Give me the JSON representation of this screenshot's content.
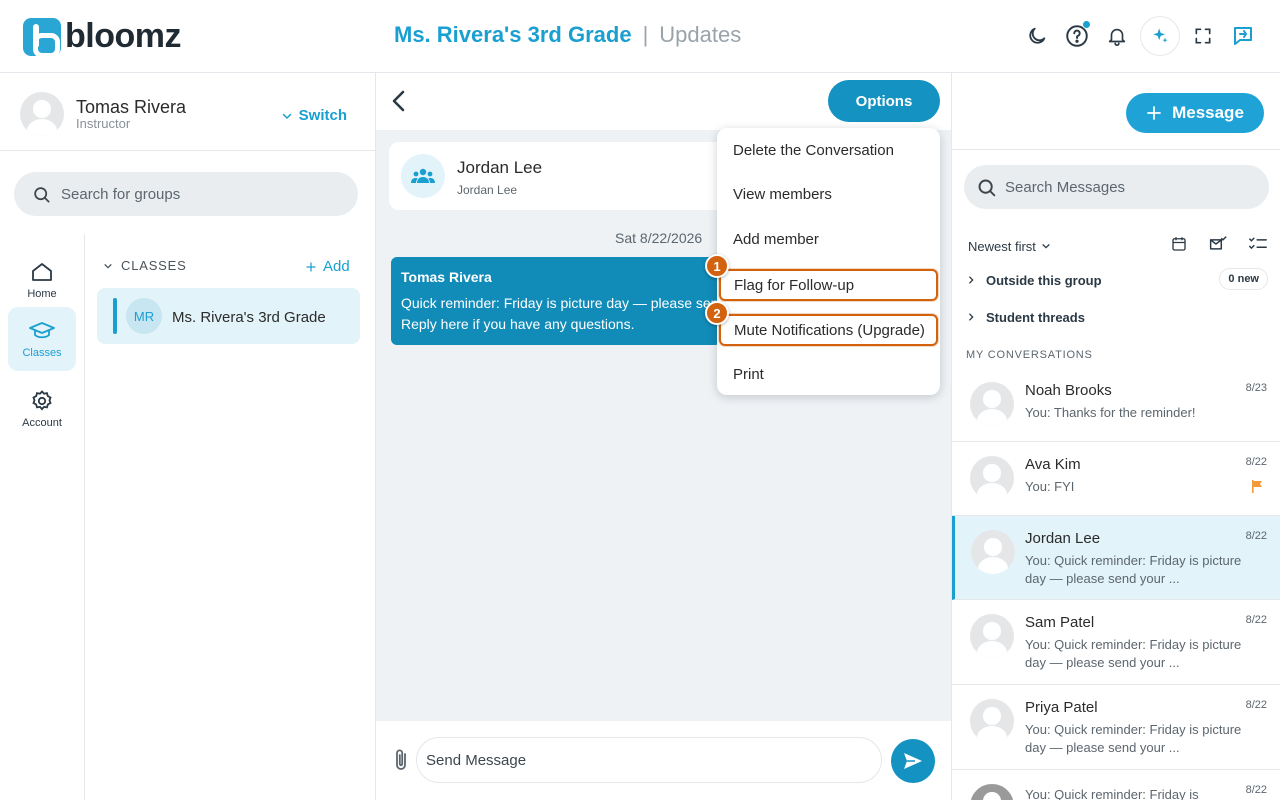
{
  "header": {
    "logo_text": "bloomz",
    "class_title": "Ms. Rivera's 3rd Grade",
    "separator": "|",
    "section_title": "Updates",
    "icons": [
      "moon-icon",
      "help-chat-icon",
      "bell-icon",
      "sparkle-icon",
      "fullscreen-icon",
      "feedback-icon"
    ],
    "accent": "#1a9fd1"
  },
  "user": {
    "name": "Tomas Rivera",
    "role": "Instructor",
    "switch_label": "Switch"
  },
  "group_search": {
    "placeholder": "Search for groups"
  },
  "nav": [
    {
      "label": "Home",
      "icon": "home-icon"
    },
    {
      "label": "Classes",
      "icon": "graduation-cap-icon",
      "active": true
    },
    {
      "label": "Account",
      "icon": "gear-icon"
    }
  ],
  "classes": {
    "header": "CLASSES",
    "add_label": "Add",
    "items": [
      {
        "initials": "MR",
        "name": "Ms. Rivera's 3rd Grade"
      }
    ]
  },
  "chat": {
    "options_label": "Options",
    "conversation": {
      "name": "Jordan Lee",
      "subtitle": "Jordan Lee"
    },
    "date_label": "Sat 8/22/2026",
    "message": {
      "sender": "Tomas Rivera",
      "text": "Quick reminder: Friday is picture day — please send your child in a school shirt. Reply here if you have any questions."
    },
    "composer_placeholder": "Send Message"
  },
  "options_menu": {
    "items": [
      {
        "label": "Delete the Conversation"
      },
      {
        "label": "View members"
      },
      {
        "label": "Add member"
      },
      {
        "label": "Flag for Follow-up",
        "highlight": true,
        "marker": "1"
      },
      {
        "label": "Mute Notifications (Upgrade)",
        "highlight": true,
        "marker": "2"
      },
      {
        "label": "Print"
      }
    ],
    "highlight_color": "#d3620e"
  },
  "messages_panel": {
    "new_message_label": "Message",
    "search_placeholder": "Search Messages",
    "sort_label": "Newest first",
    "filter_icons": [
      "calendar-icon",
      "mail-check-icon",
      "checklist-icon"
    ],
    "groups": [
      {
        "label": "Outside this group",
        "badge": "0 new"
      },
      {
        "label": "Student threads"
      }
    ],
    "section_label": "MY CONVERSATIONS",
    "conversations": [
      {
        "name": "Noah Brooks",
        "date": "8/23",
        "preview": "You: Thanks for the reminder!"
      },
      {
        "name": "Ava Kim",
        "date": "8/22",
        "preview": "You: FYI",
        "flagged": true
      },
      {
        "name": "Jordan Lee",
        "date": "8/22",
        "preview": "You: Quick reminder: Friday is picture day — please send your ...",
        "active": true
      },
      {
        "name": "Sam Patel",
        "date": "8/22",
        "preview": "You: Quick reminder: Friday is picture day — please send your ..."
      },
      {
        "name": "Priya Patel",
        "date": "8/22",
        "preview": "You: Quick reminder: Friday is picture day — please send your ..."
      },
      {
        "name": "",
        "date": "8/22",
        "preview": "You: Quick reminder: Friday is"
      }
    ]
  }
}
